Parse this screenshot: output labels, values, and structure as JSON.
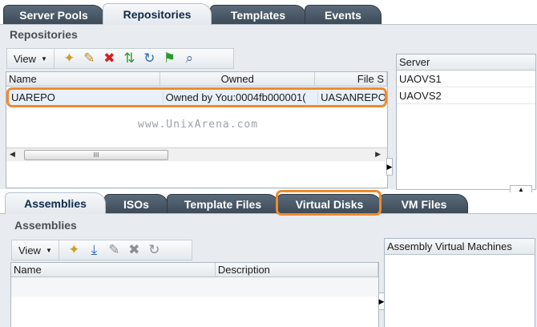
{
  "top_tabs": [
    "Server Pools",
    "Repositories",
    "Templates",
    "Events"
  ],
  "repositories": {
    "title": "Repositories",
    "view_label": "View",
    "columns": [
      "Name",
      "Owned",
      "File S"
    ],
    "rows": [
      {
        "name": "UAREPO",
        "owned": "Owned by You:0004fb000001(",
        "file_server": "UASANREPO:"
      }
    ],
    "watermark": "www.UnixArena.com"
  },
  "servers": {
    "header": "Server",
    "items": [
      "UAOVS1",
      "UAOVS2"
    ]
  },
  "bottom_tabs": [
    "Assemblies",
    "ISOs",
    "Template Files",
    "Virtual Disks",
    "VM Files"
  ],
  "assemblies": {
    "title": "Assemblies",
    "view_label": "View",
    "columns": [
      "Name",
      "Description"
    ],
    "side_header": "Assembly Virtual Machines"
  },
  "colors": {
    "highlight": "#f08a2c",
    "tab_dark": "#3e4b58",
    "panel_bg": "#e8ecf0"
  }
}
